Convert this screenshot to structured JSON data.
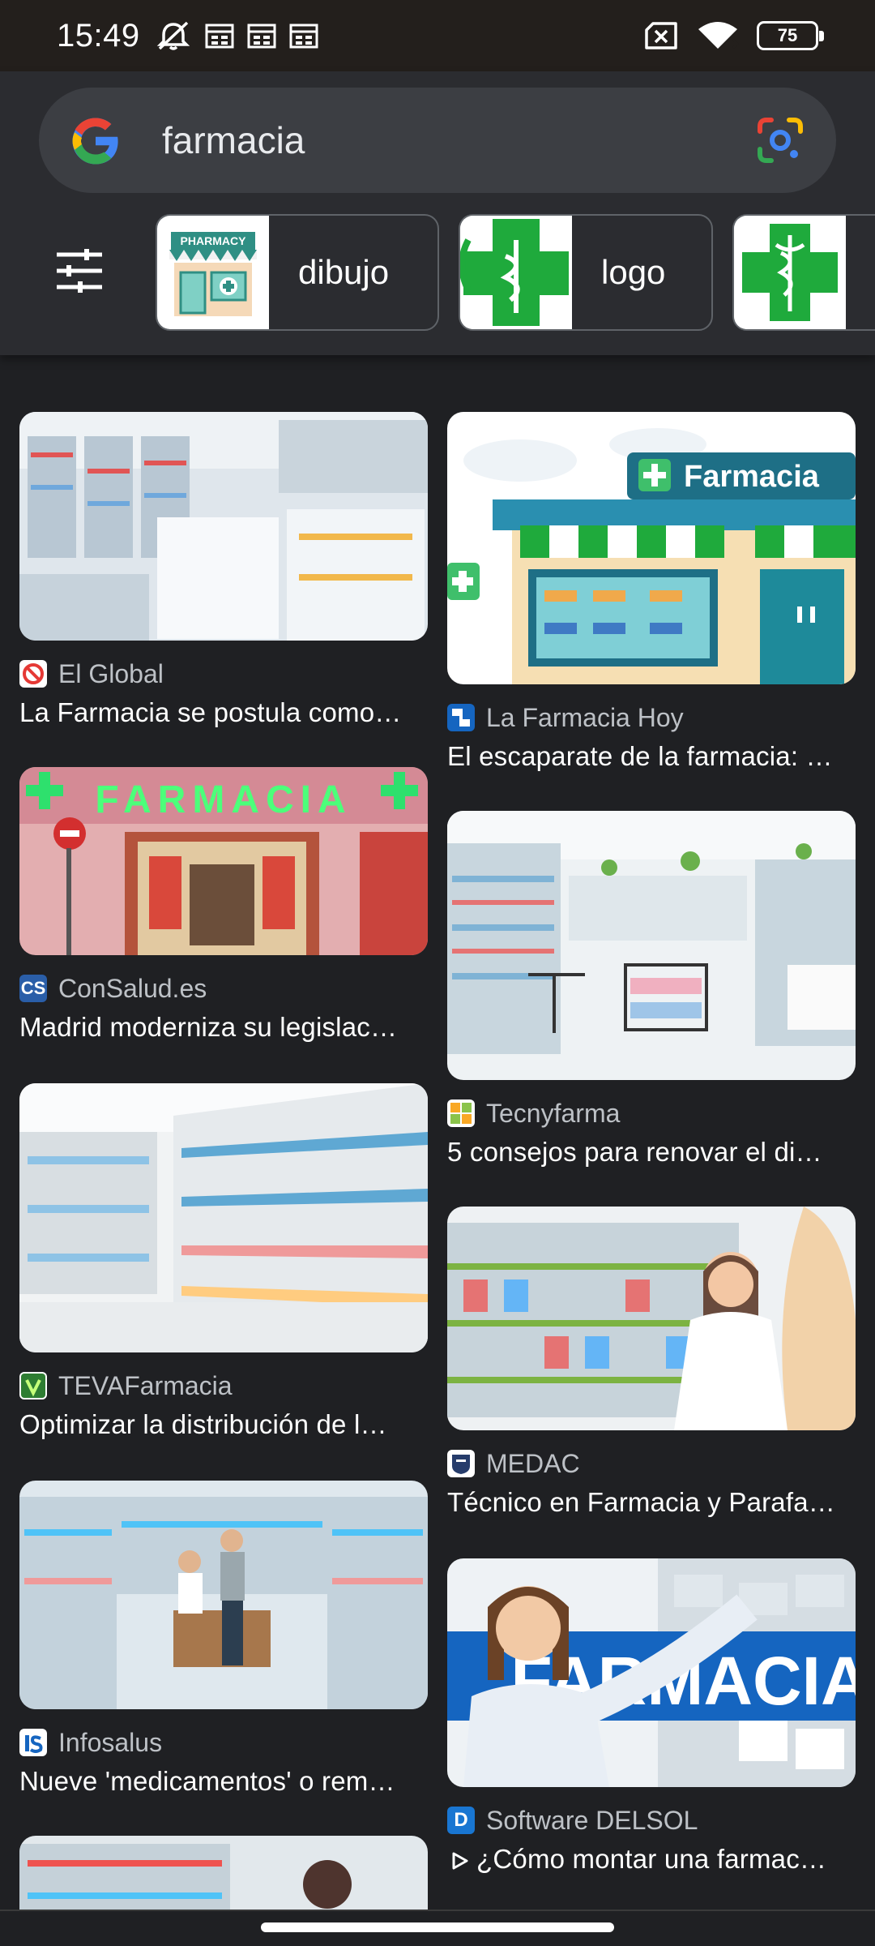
{
  "status_bar": {
    "time": "15:49",
    "battery": "75",
    "icons": [
      "mute-icon",
      "calendar-icon",
      "calendar-icon",
      "calendar-icon",
      "no-sim-icon",
      "wifi-icon",
      "battery-icon"
    ]
  },
  "search": {
    "query": "farmacia",
    "icons": [
      "google-logo",
      "lens-icon"
    ]
  },
  "chips": [
    {
      "label": "dibujo"
    },
    {
      "label": "logo"
    },
    {
      "label": ""
    }
  ],
  "results": [
    {
      "source": "El Global",
      "title": "La Farmacia se postula como…"
    },
    {
      "source": "La Farmacia Hoy",
      "title": "El escaparate de la farmacia: …"
    },
    {
      "source": "ConSalud.es",
      "title": "Madrid moderniza su legislac…"
    },
    {
      "source": "Tecnyfarma",
      "title": "5 consejos para renovar el di…"
    },
    {
      "source": "TEVAFarmacia",
      "title": "Optimizar la distribución de l…"
    },
    {
      "source": "MEDAC",
      "title": "Técnico en Farmacia y Parafa…"
    },
    {
      "source": "Infosalus",
      "title": "Nueve 'medicamentos' o rem…"
    },
    {
      "source": "Software DELSOL",
      "title": "¿Cómo montar una farmac…"
    }
  ],
  "images": {
    "farmacia_sign": "Farmacia",
    "farmacia_sign2": "FARMACIA",
    "farmacia_banner": "FARMACIA",
    "pharmacy_chip": "PHARMACY"
  },
  "colors": {
    "background": "#1f2023",
    "header": "#2b2c30",
    "search_bar": "#3c3e43",
    "pharmacy_green": "#1faa3c"
  }
}
